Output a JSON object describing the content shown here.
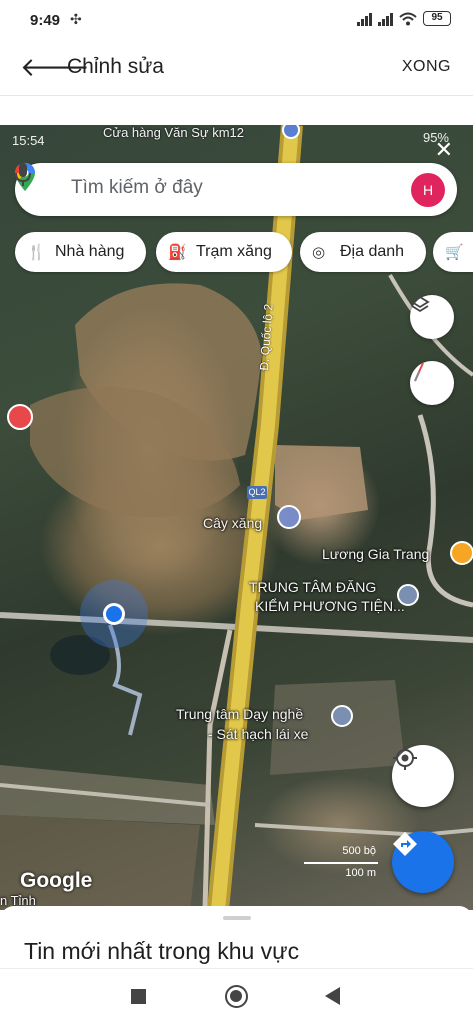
{
  "status_bar": {
    "time": "9:49",
    "battery": "95"
  },
  "app_bar": {
    "title": "Chỉnh sửa",
    "done_label": "XONG"
  },
  "map_screenshot": {
    "overlay_time": "15:54",
    "overlay_top_label": "Cửa hàng Văn Sự km12",
    "overlay_status_right": "95%",
    "search": {
      "placeholder": "Tìm kiếm ở đây",
      "avatar_letter": "H"
    },
    "chips": [
      {
        "label": "Nhà hàng",
        "icon": "fork-knife-icon"
      },
      {
        "label": "Trạm xăng",
        "icon": "gas-station-icon"
      },
      {
        "label": "Địa danh",
        "icon": "camera-icon"
      },
      {
        "label": "",
        "icon": "shopping-cart-icon"
      }
    ],
    "labels": {
      "road": "Đ. Quốc lộ 2",
      "road_badge": "QL2",
      "gas_station": "Cây xăng",
      "restaurant": "Lương Gia Trang",
      "inspection_line1": "TRUNG TÂM ĐĂNG",
      "inspection_line2": "KIỂM PHƯƠNG TIỆN...",
      "school_line1": "Trung tâm Dạy nghề",
      "school_line2": "- Sát hạch lái xe",
      "scale_top": "500 bộ",
      "scale_bottom": "100 m",
      "google": "Google",
      "left_edge": "n Tỉnh"
    }
  },
  "sheet": {
    "title": "Tin mới nhất trong khu vực"
  },
  "colors": {
    "accent_blue": "#1a73e8",
    "avatar_pink": "#e0245e",
    "restaurant_orange": "#f6a623",
    "pin_red": "#e8484a"
  }
}
